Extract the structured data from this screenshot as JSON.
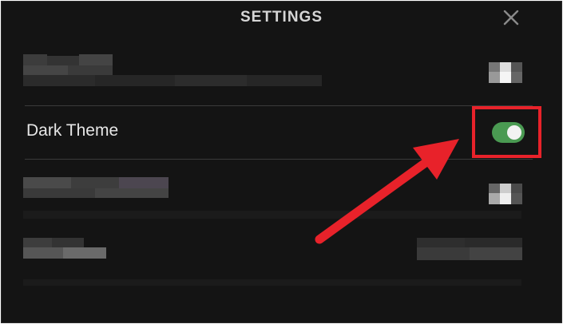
{
  "dialog": {
    "title": "SETTINGS",
    "close_icon": "close-icon"
  },
  "settings": [
    {
      "id": "blurred-1",
      "label": null,
      "obscured": true
    },
    {
      "id": "dark-theme",
      "label": "Dark Theme",
      "control": "toggle",
      "enabled": true
    },
    {
      "id": "blurred-2",
      "label": null,
      "obscured": true
    },
    {
      "id": "blurred-3",
      "label": null,
      "obscured": true
    }
  ],
  "annotation": {
    "type": "callout-arrow",
    "color": "#e8222a",
    "target": "dark-theme-toggle"
  },
  "colors": {
    "background": "#141414",
    "toggle_on": "#4a9a52",
    "annotation_red": "#e8222a"
  }
}
